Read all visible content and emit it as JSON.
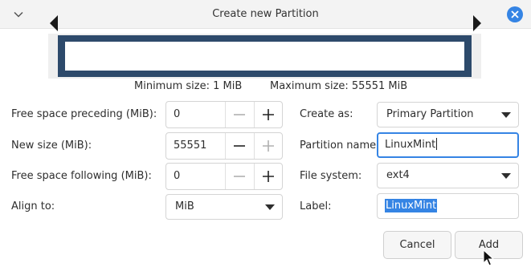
{
  "window": {
    "title": "Create new Partition",
    "collapse_icon": "chevron-down-icon",
    "close_icon": "close-icon",
    "accent": "#3584e4"
  },
  "partition_bar": {
    "frame_color": "#2d4a6b"
  },
  "size_info": {
    "minimum": "Minimum size: 1 MiB",
    "maximum": "Maximum size: 55551 MiB"
  },
  "left_form": {
    "free_preceding_label": "Free space preceding (MiB):",
    "free_preceding_value": "0",
    "new_size_label": "New size (MiB):",
    "new_size_value": "55551",
    "free_following_label": "Free space following (MiB):",
    "free_following_value": "0",
    "align_label": "Align to:",
    "align_value": "MiB"
  },
  "right_form": {
    "create_as_label": "Create as:",
    "create_as_value": "Primary Partition",
    "partition_name_label": "Partition name:",
    "partition_name_value": "LinuxMint",
    "file_system_label": "File system:",
    "file_system_value": "ext4",
    "label_label": "Label:",
    "label_value": "LinuxMint"
  },
  "buttons": {
    "cancel": "Cancel",
    "add": "Add"
  }
}
